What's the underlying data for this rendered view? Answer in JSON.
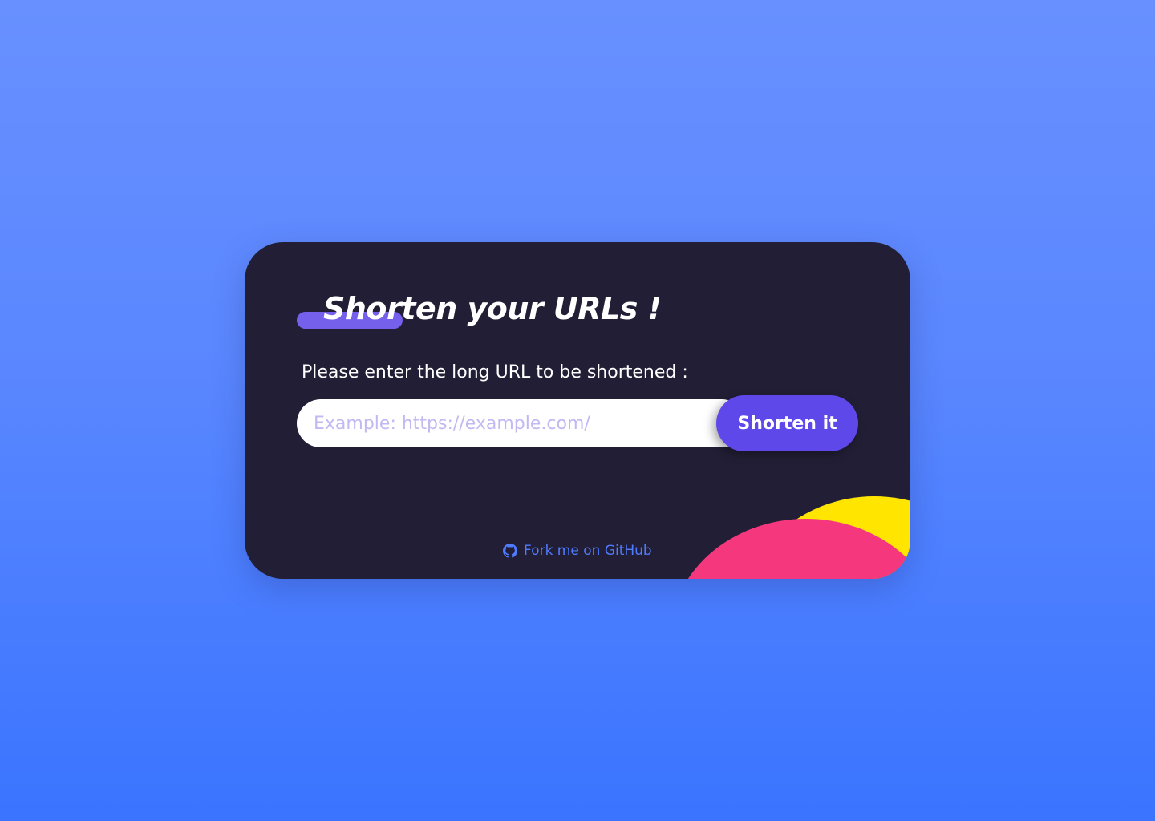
{
  "card": {
    "title": "Shorten your URLs !",
    "prompt": "Please enter the long URL to be shortened :",
    "input": {
      "placeholder": "Example: https://example.com/",
      "value": ""
    },
    "button_label": "Shorten it",
    "github": {
      "icon": "github-icon",
      "label": "Fork me on GitHub"
    }
  },
  "colors": {
    "background_top": "#6890ff",
    "background_bottom": "#3a74ff",
    "card": "#221e35",
    "accent": "#5f48ea",
    "title_underline": "#7560ec",
    "placeholder": "#c1b9f1",
    "link": "#4f7bff",
    "blob_yellow": "#ffe500",
    "blob_pink": "#f5377d"
  }
}
